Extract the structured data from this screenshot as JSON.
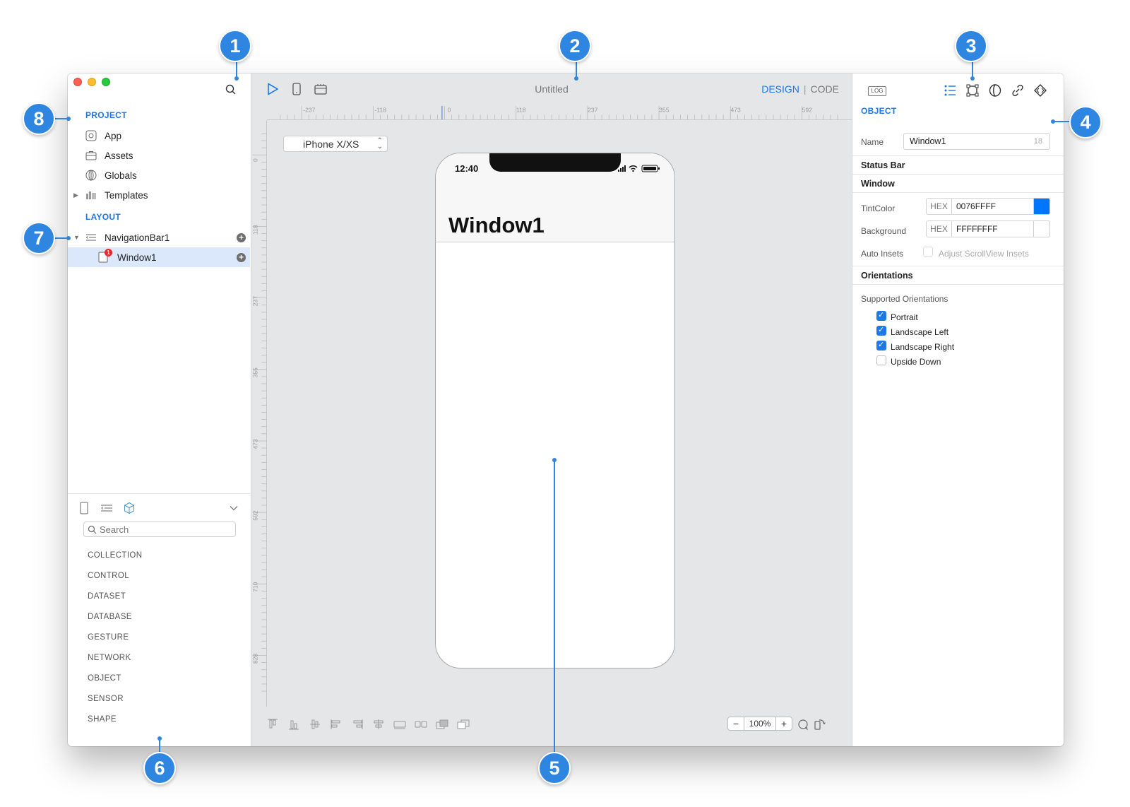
{
  "window": {
    "title": "Untitled",
    "mode": {
      "design": "DESIGN",
      "separator": "|",
      "code": "CODE"
    }
  },
  "sidebar": {
    "project_heading": "PROJECT",
    "project_items": [
      {
        "label": "App",
        "icon": "app-icon"
      },
      {
        "label": "Assets",
        "icon": "briefcase-icon"
      },
      {
        "label": "Globals",
        "icon": "globe-icon"
      },
      {
        "label": "Templates",
        "icon": "templates-icon"
      }
    ],
    "layout_heading": "LAYOUT",
    "layout_items": [
      {
        "label": "NavigationBar1",
        "icon": "navigation-bar-icon"
      },
      {
        "label": "Window1",
        "icon": "window-icon",
        "badge": "1"
      }
    ],
    "library": {
      "search_placeholder": "Search",
      "categories": [
        "COLLECTION",
        "CONTROL",
        "DATASET",
        "DATABASE",
        "GESTURE",
        "NETWORK",
        "OBJECT",
        "SENSOR",
        "SHAPE"
      ]
    }
  },
  "canvas": {
    "device": "iPhone X/XS",
    "ruler_h": [
      "-237",
      "-118",
      "0",
      "118",
      "237",
      "355",
      "473",
      "592"
    ],
    "ruler_v": [
      "0",
      "118",
      "237",
      "355",
      "473",
      "592",
      "710",
      "828"
    ],
    "phone": {
      "time": "12:40",
      "title": "Window1"
    },
    "zoom": {
      "minus": "−",
      "value": "100%",
      "plus": "+"
    }
  },
  "inspector": {
    "log_label": "LOG",
    "heading": "OBJECT",
    "name_label": "Name",
    "name_value": "Window1",
    "name_count": "18",
    "status_bar": "Status Bar",
    "window_section": "Window",
    "tint_label": "TintColor",
    "tint_prefix": "HEX",
    "tint_value": "0076FFFF",
    "tint_color": "#0076FF",
    "background_label": "Background",
    "background_prefix": "HEX",
    "background_value": "FFFFFFFF",
    "background_color": "#FFFFFF",
    "auto_insets_label": "Auto Insets",
    "adjust_label": "Adjust ScrollView Insets",
    "orientations_section": "Orientations",
    "supported_label": "Supported Orientations",
    "orientations": [
      {
        "label": "Portrait",
        "checked": true
      },
      {
        "label": "Landscape Left",
        "checked": true
      },
      {
        "label": "Landscape Right",
        "checked": true
      },
      {
        "label": "Upside Down",
        "checked": false
      }
    ]
  },
  "callouts": [
    "1",
    "2",
    "3",
    "4",
    "5",
    "6",
    "7",
    "8"
  ],
  "colors": {
    "accent": "#1E78E6",
    "callout": "#2F86E0",
    "selection": "#DBE7FB"
  }
}
